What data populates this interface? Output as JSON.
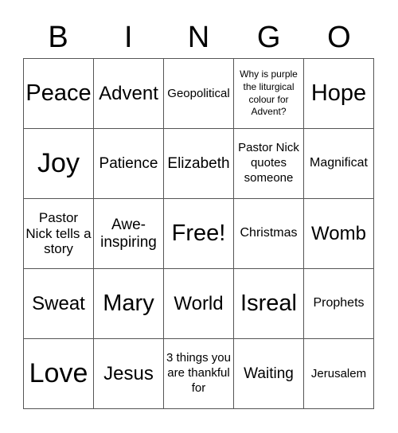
{
  "header": {
    "letters": [
      "B",
      "I",
      "N",
      "G",
      "O"
    ]
  },
  "card": {
    "cells": [
      [
        "Peace",
        "Advent",
        "Geopolitical",
        "Why is purple the liturgical colour for Advent?",
        "Hope"
      ],
      [
        "Joy",
        "Patience",
        "Elizabeth",
        "Pastor Nick quotes someone",
        "Magnificat"
      ],
      [
        "Pastor Nick tells a story",
        "Awe-inspiring",
        "Free!",
        "Christmas",
        "Womb"
      ],
      [
        "Sweat",
        "Mary",
        "World",
        "Isreal",
        "Prophets"
      ],
      [
        "Love",
        "Jesus",
        "3 things you are thankful for",
        "Waiting",
        "Jerusalem"
      ]
    ]
  }
}
